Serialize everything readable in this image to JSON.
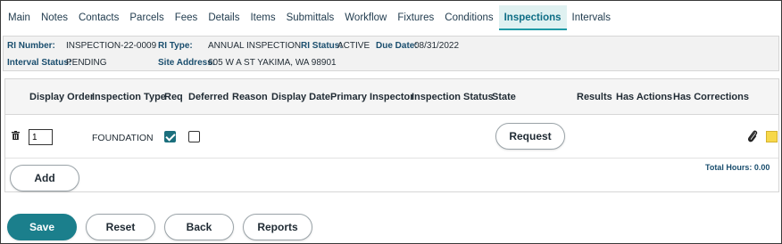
{
  "tabs": [
    {
      "label": "Main"
    },
    {
      "label": "Notes"
    },
    {
      "label": "Contacts"
    },
    {
      "label": "Parcels"
    },
    {
      "label": "Fees"
    },
    {
      "label": "Details"
    },
    {
      "label": "Items"
    },
    {
      "label": "Submittals"
    },
    {
      "label": "Workflow"
    },
    {
      "label": "Fixtures"
    },
    {
      "label": "Conditions"
    },
    {
      "label": "Inspections",
      "active": true
    },
    {
      "label": "Intervals"
    }
  ],
  "info": {
    "ri_number_label": "RI Number:",
    "ri_number": "INSPECTION-22-0009",
    "ri_type_label": "RI Type:",
    "ri_type": "ANNUAL INSPECTION",
    "ri_status_label": "RI Status:",
    "ri_status": "ACTIVE",
    "due_date_label": "Due Date:",
    "due_date": "08/31/2022",
    "interval_status_label": "Interval Status:",
    "interval_status": "PENDING",
    "site_address_label": "Site Address:",
    "site_address": "605 W A ST  YAKIMA, WA 98901"
  },
  "grid": {
    "columns": [
      "Display Order",
      "Inspection Type",
      "Req",
      "Deferred",
      "Reason",
      "Display Date",
      "Primary Inspector",
      "Inspection Status",
      "State",
      "Results",
      "Has Actions",
      "Has Corrections"
    ],
    "rows": [
      {
        "display_order": "1",
        "inspection_type": "FOUNDATION",
        "req": true,
        "deferred": false,
        "state_button": "Request"
      }
    ],
    "add_label": "Add",
    "total_hours": "Total Hours: 0.00"
  },
  "footer": {
    "save": "Save",
    "reset": "Reset",
    "back": "Back",
    "reports": "Reports"
  },
  "colors": {
    "accent": "#1b7f8c",
    "active_tab_bg": "#dff1f1",
    "info_bg": "#f2f2f2",
    "note_yellow": "#f7d84a"
  }
}
